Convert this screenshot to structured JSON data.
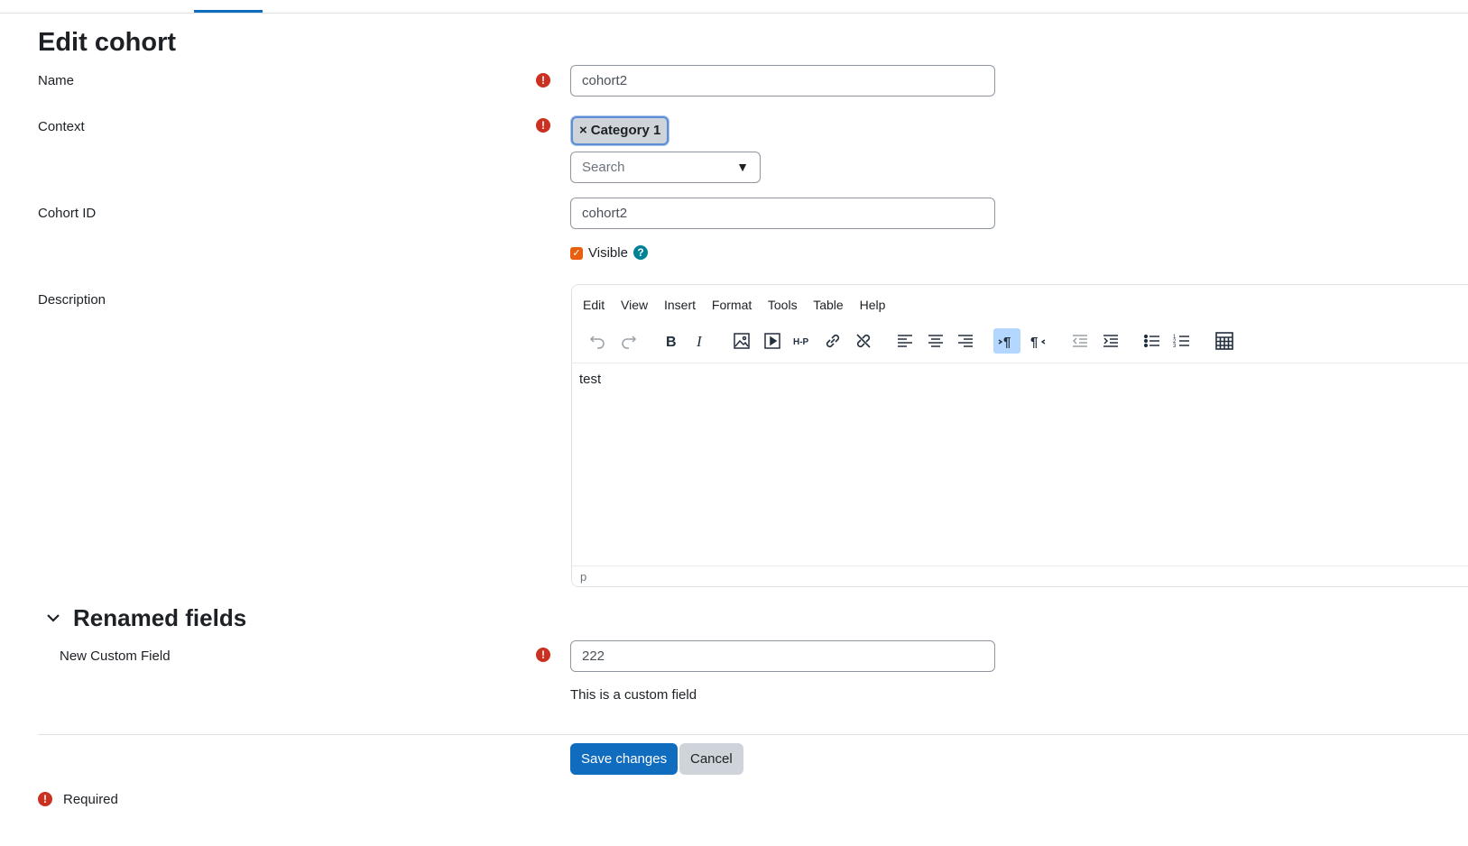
{
  "page": {
    "title": "Edit cohort"
  },
  "form": {
    "name": {
      "label": "Name",
      "value": "cohort2"
    },
    "context": {
      "label": "Context",
      "selected_chip": "Category 1",
      "chip_remove": "×",
      "search_placeholder": "Search",
      "dropdown_arrow": "▼"
    },
    "cohort_id": {
      "label": "Cohort ID",
      "value": "cohort2"
    },
    "visible": {
      "label": "Visible",
      "checked": true,
      "help": "?"
    },
    "description": {
      "label": "Description",
      "menu": [
        "Edit",
        "View",
        "Insert",
        "Format",
        "Tools",
        "Table",
        "Help"
      ],
      "toolbar_icons": [
        "undo-icon",
        "redo-icon",
        "bold-icon",
        "italic-icon",
        "image-icon",
        "media-icon",
        "h5p-icon",
        "link-icon",
        "unlink-icon",
        "align-left-icon",
        "align-center-icon",
        "align-right-icon",
        "ltr-icon",
        "rtl-icon",
        "outdent-icon",
        "indent-icon",
        "bullet-list-icon",
        "numbered-list-icon",
        "table-icon"
      ],
      "content": "test",
      "status_path": "p"
    }
  },
  "renamed_section": {
    "title": "Renamed fields",
    "field": {
      "label": "New Custom Field",
      "value": "222",
      "note": "This is a custom field"
    }
  },
  "actions": {
    "save": "Save changes",
    "cancel": "Cancel"
  },
  "footer": {
    "required_label": "Required"
  },
  "icons": {
    "required": "!"
  },
  "colors": {
    "primary": "#0f6cbf",
    "required": "#ca3120",
    "help": "#008196",
    "checkbox": "#e8600f"
  }
}
